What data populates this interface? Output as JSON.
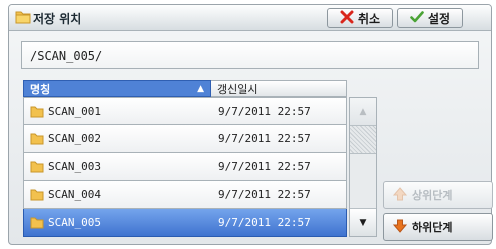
{
  "dialog": {
    "title": "저장 위치",
    "cancel_label": "취소",
    "ok_label": "설정"
  },
  "path": {
    "value": "/SCAN_005/"
  },
  "table": {
    "headers": {
      "name": "명칭",
      "date": "갱신일시"
    },
    "sort_indicator": "▲",
    "rows": [
      {
        "name": "SCAN_001",
        "date": "9/7/2011 22:57",
        "selected": false
      },
      {
        "name": "SCAN_002",
        "date": "9/7/2011 22:57",
        "selected": false
      },
      {
        "name": "SCAN_003",
        "date": "9/7/2011 22:57",
        "selected": false
      },
      {
        "name": "SCAN_004",
        "date": "9/7/2011 22:57",
        "selected": false
      },
      {
        "name": "SCAN_005",
        "date": "9/7/2011 22:57",
        "selected": true
      }
    ]
  },
  "nav": {
    "up_label": "상위단계",
    "down_label": "하위단계"
  },
  "colors": {
    "selection": "#4f82d6",
    "folder": "#f2c14e",
    "cancel_x": "#d9261c",
    "check": "#4aa335",
    "down_arrow": "#e8731e"
  }
}
